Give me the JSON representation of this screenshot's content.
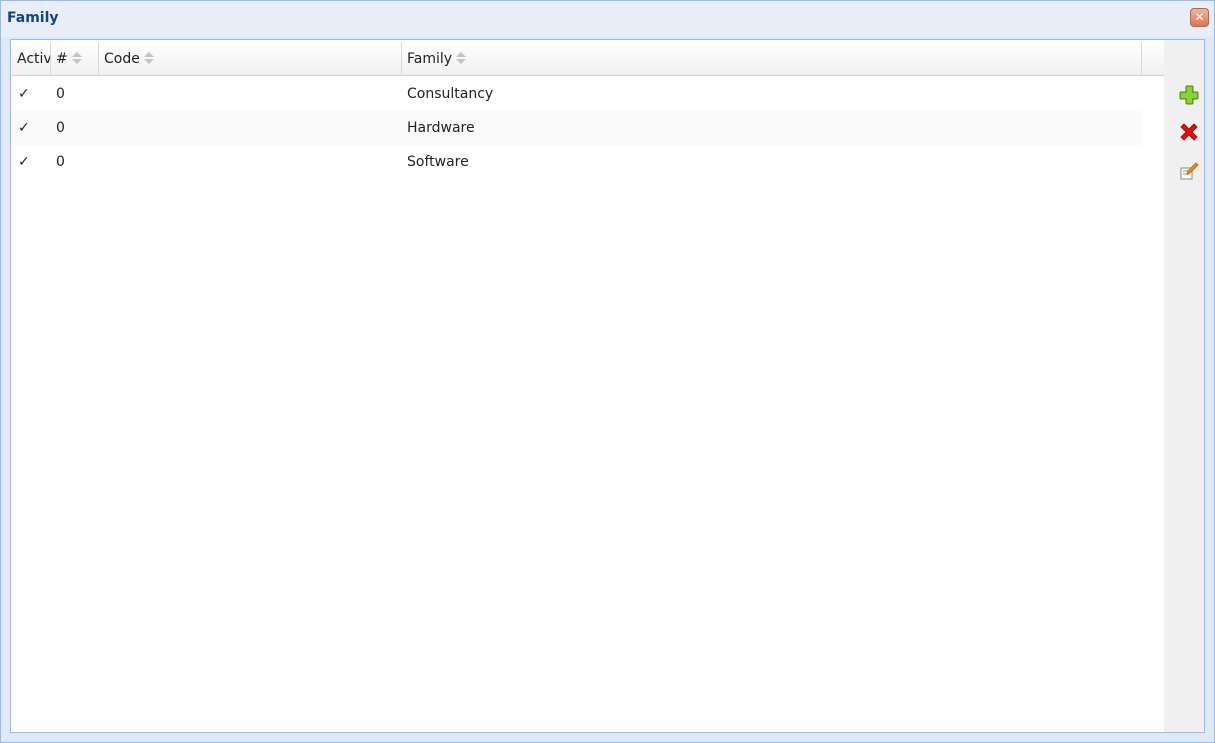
{
  "window": {
    "title": "Family",
    "close_label": "x"
  },
  "grid": {
    "columns": [
      {
        "label": "Activ",
        "sortable": false
      },
      {
        "label": "#",
        "sortable": true
      },
      {
        "label": "Code",
        "sortable": true
      },
      {
        "label": "Family",
        "sortable": true
      }
    ],
    "rows": [
      {
        "active": "✓",
        "num": "0",
        "code": "",
        "family": "Consultancy"
      },
      {
        "active": "✓",
        "num": "0",
        "code": "",
        "family": "Hardware"
      },
      {
        "active": "✓",
        "num": "0",
        "code": "",
        "family": "Software"
      }
    ]
  },
  "toolbar": {
    "add_icon": "plus-icon",
    "delete_icon": "delete-x-icon",
    "edit_icon": "edit-icon"
  },
  "colors": {
    "title": "#15428b",
    "border": "#99bbe8",
    "add": "#6aaa1e",
    "delete": "#e01010"
  }
}
